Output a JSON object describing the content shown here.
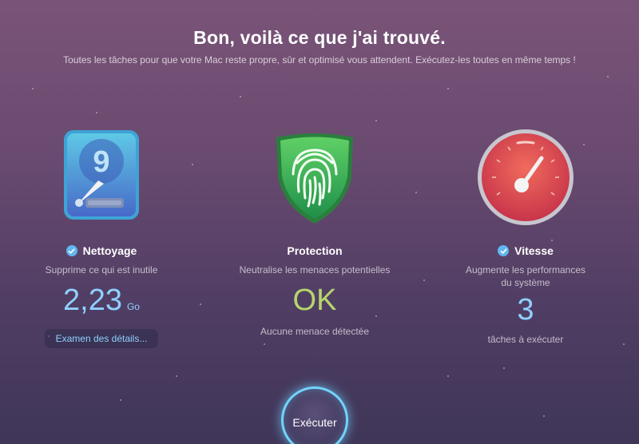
{
  "header": {
    "title": "Bon, voilà ce que j'ai trouvé.",
    "subtitle": "Toutes les tâches pour que votre Mac reste propre, sûr et optimisé vous attendent. Exécutez-les toutes en même temps !"
  },
  "cleanup": {
    "icon": "hard-drive-icon",
    "title": "Nettoyage",
    "description": "Supprime ce qui est inutile",
    "value": "2,23",
    "unit": "Go",
    "details_button": "Examen des détails..."
  },
  "protection": {
    "icon": "fingerprint-shield-icon",
    "title": "Protection",
    "description": "Neutralise les menaces potentielles",
    "value": "OK",
    "note": "Aucune menace détectée"
  },
  "speed": {
    "icon": "speedometer-icon",
    "title": "Vitesse",
    "description_line1": "Augmente les performances",
    "description_line2": "du système",
    "value": "3",
    "note": "tâches à exécuter"
  },
  "run_button": "Exécuter",
  "colors": {
    "accent_blue": "#8fd0ff",
    "ok_green": "#b6d66a",
    "check_blue": "#62b5f0"
  }
}
